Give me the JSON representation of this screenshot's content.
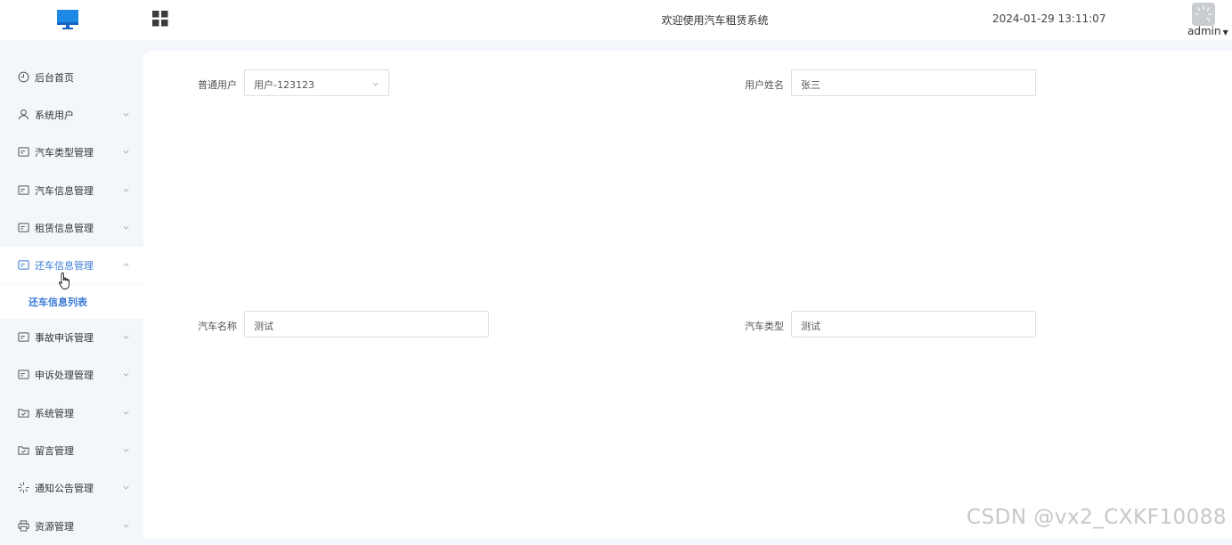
{
  "header": {
    "title": "欢迎使用汽车租赁系统",
    "datetime": "2024-01-29 13:11:07",
    "user": "admin",
    "logo_icon": "monitor-icon",
    "menu_icon": "grid-icon",
    "brand_color": "#1e88e5"
  },
  "sidebar": {
    "items": [
      {
        "label": "后台首页",
        "icon": "clock-icon",
        "arrow": false
      },
      {
        "label": "系统用户",
        "icon": "user-icon",
        "arrow": true
      },
      {
        "label": "汽车类型管理",
        "icon": "card-icon",
        "arrow": true
      },
      {
        "label": "汽车信息管理",
        "icon": "card-icon",
        "arrow": true
      },
      {
        "label": "租赁信息管理",
        "icon": "card-icon",
        "arrow": true
      },
      {
        "label": "还车信息管理",
        "icon": "card-icon",
        "arrow": true,
        "open": true
      },
      {
        "label": "事故申诉管理",
        "icon": "card-icon",
        "arrow": true
      },
      {
        "label": "申诉处理管理",
        "icon": "card-icon",
        "arrow": true
      },
      {
        "label": "系统管理",
        "icon": "folder-check-icon",
        "arrow": true
      },
      {
        "label": "留言管理",
        "icon": "folder-check-icon",
        "arrow": true
      },
      {
        "label": "通知公告管理",
        "icon": "loading-icon",
        "arrow": true
      },
      {
        "label": "资源管理",
        "icon": "printer-icon",
        "arrow": true
      }
    ],
    "sub_item": "还车信息列表",
    "active_color": "#3a7bd5"
  },
  "form": {
    "user_label": "普通用户",
    "user_value": "用户-123123",
    "name_label": "用户姓名",
    "name_value": "张三",
    "car_name_label": "汽车名称",
    "car_name_value": "测试",
    "car_type_label": "汽车类型",
    "car_type_value": "测试"
  },
  "watermark": "CSDN @vx2_CXKF10088"
}
